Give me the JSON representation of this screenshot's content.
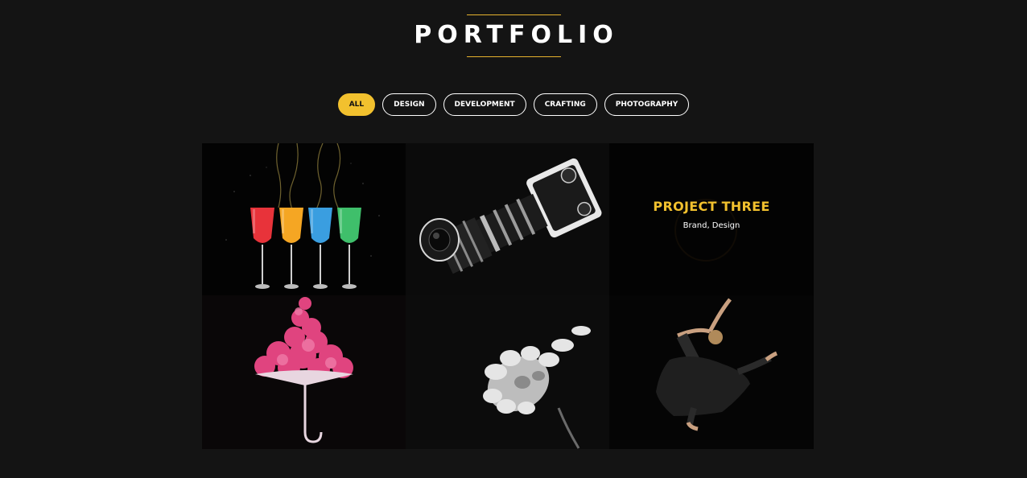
{
  "heading": {
    "title": "PORTFOLIO"
  },
  "colors": {
    "background": "#141414",
    "accent": "#f2c12e",
    "text": "#ffffff"
  },
  "filters": [
    {
      "label": "ALL",
      "active": true
    },
    {
      "label": "DESIGN",
      "active": false
    },
    {
      "label": "DEVELOPMENT",
      "active": false
    },
    {
      "label": "CRAFTING",
      "active": false
    },
    {
      "label": "PHOTOGRAPHY",
      "active": false
    }
  ],
  "projects": [
    {
      "image": "colorful-cocktail-glasses-splash-photo"
    },
    {
      "image": "black-camera-with-telephoto-lens-photo"
    },
    {
      "image": "hovered-project-dark-photo",
      "title": "PROJECT THREE",
      "category": "Brand, Design"
    },
    {
      "image": "pink-ink-cloud-umbrella-photo"
    },
    {
      "image": "monochrome-flower-photo"
    },
    {
      "image": "leaping-dancer-photo"
    }
  ]
}
